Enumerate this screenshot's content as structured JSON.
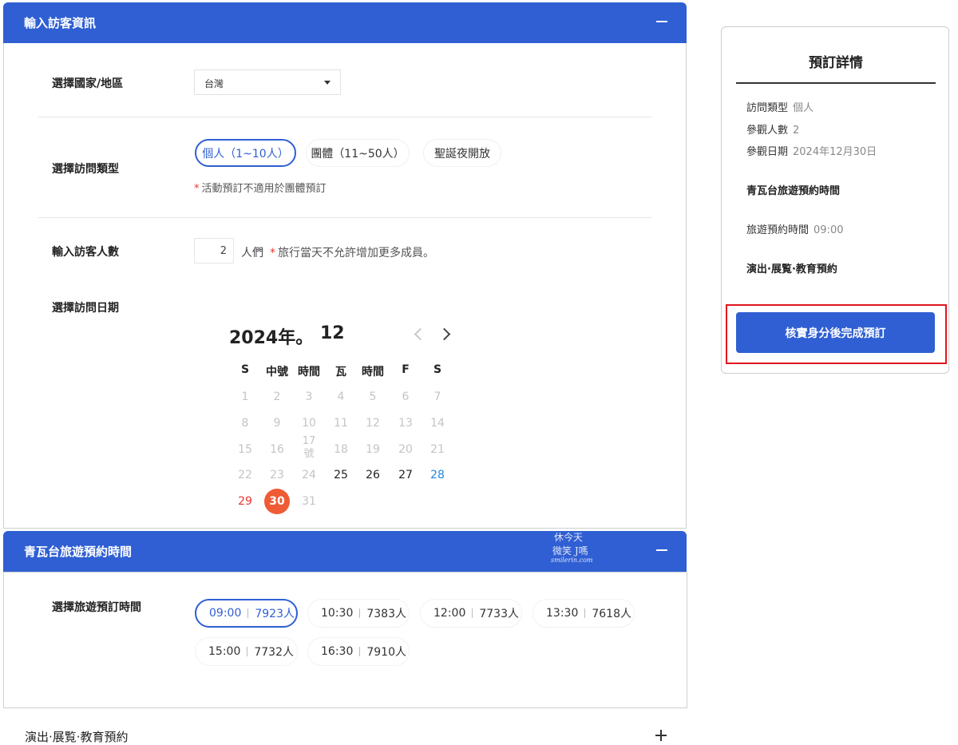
{
  "visitor_section": {
    "title": "輸入訪客資訊",
    "country_label": "選擇國家/地區",
    "country_value": "台灣",
    "visit_type_label": "選擇訪問類型",
    "visit_types": [
      "個人（1~10人）",
      "團體（11~50人）",
      "聖誕夜開放"
    ],
    "visit_type_note": "活動預訂不適用於團體預訂",
    "count_label": "輸入訪客人數",
    "count_value": "2",
    "count_unit": "人們",
    "count_note": "旅行當天不允許增加更多成員。",
    "date_label": "選擇訪問日期"
  },
  "calendar": {
    "year": "2024年。",
    "month": "12",
    "weekdays": [
      "S",
      "中號",
      "時間",
      "瓦",
      "時間",
      "F",
      "S"
    ],
    "weeks": [
      [
        "1",
        "2",
        "3",
        "4",
        "5",
        "6",
        "7"
      ],
      [
        "8",
        "9",
        "10",
        "11",
        "12",
        "13",
        "14"
      ],
      [
        "15",
        "16",
        "17號",
        "18",
        "19",
        "20",
        "21"
      ],
      [
        "22",
        "23",
        "24",
        "25",
        "26",
        "27",
        "28"
      ],
      [
        "29",
        "30",
        "31"
      ]
    ],
    "selected_day": "30"
  },
  "tour_section": {
    "title": "青瓦台旅遊預約時間",
    "time_label": "選擇旅遊預訂時間",
    "slots": [
      {
        "time": "09:00",
        "count": "7923人"
      },
      {
        "time": "10:30",
        "count": "7383人"
      },
      {
        "time": "12:00",
        "count": "7733人"
      },
      {
        "time": "13:30",
        "count": "7618人"
      },
      {
        "time": "15:00",
        "count": "7732人"
      },
      {
        "time": "16:30",
        "count": "7910人"
      }
    ]
  },
  "performance_section": {
    "title": "演出·展覧·教育預約"
  },
  "summary": {
    "title": "預訂詳情",
    "type_key": "訪問類型",
    "type_value": "個人",
    "count_key": "參觀人數",
    "count_value": "2",
    "date_key": "參觀日期",
    "date_value": "2024年12月30日",
    "tour_heading": "青瓦台旅遊預約時間",
    "tour_key": "旅遊預約時間",
    "tour_value": "09:00",
    "performance_heading": "演出·展覧·教育預約",
    "cta": "核實身分後完成預訂"
  },
  "watermark": {
    "line1": "休今天",
    "line2": "微笑 J嗎",
    "line3": "smilerin.com"
  },
  "colors": {
    "primary": "#2f5fd3",
    "selected_day": "#ef5b35",
    "sunday": "#e53935",
    "saturday": "#1e88e5",
    "highlight_border": "#e0141e"
  }
}
